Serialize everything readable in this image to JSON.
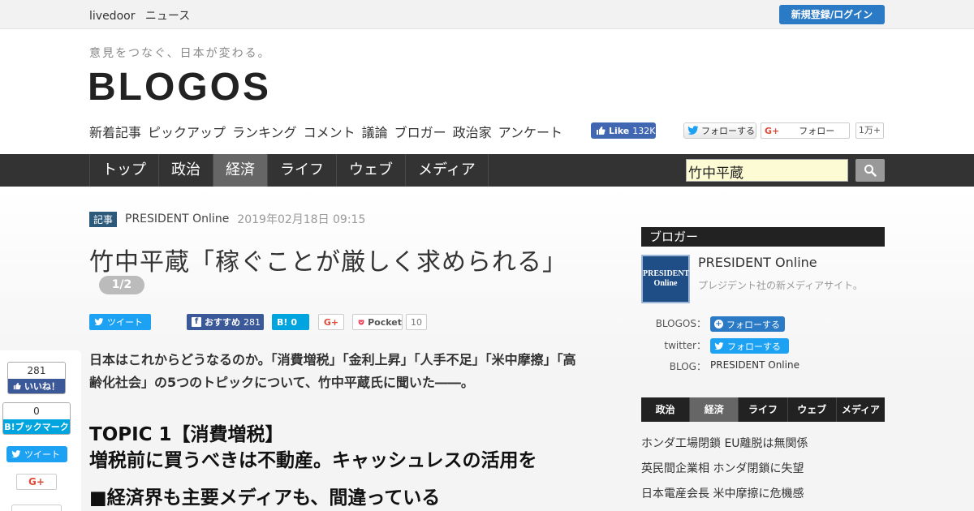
{
  "topbar": {
    "brand1": "livedoor",
    "brand2": "ニュース",
    "login": "新規登録/ログイン"
  },
  "header": {
    "tagline": "意見をつなぐ、日本が変わる。",
    "logo": "BLOGOS",
    "nav": [
      "新着記事",
      "ピックアップ",
      "ランキング",
      "コメント",
      "議論",
      "ブロガー",
      "政治家",
      "アンケート"
    ],
    "fb_like_label": "Like",
    "fb_like_count": "132K",
    "tw_follow": "フォローする",
    "gp_follow": "フォロー",
    "gp_count": "1万+"
  },
  "categories": {
    "tabs": [
      "トップ",
      "政治",
      "経済",
      "ライフ",
      "ウェブ",
      "メディア"
    ],
    "active": "経済"
  },
  "search": {
    "value": "竹中平蔵"
  },
  "article": {
    "badge": "記事",
    "source": "PRESIDENT Online",
    "date": "2019年02月18日 09:15",
    "title": "竹中平蔵「稼ぐことが厳しく求められる」",
    "page": "1/2",
    "share": {
      "tweet": "ツイート",
      "fb_label": "おすすめ",
      "fb_count": "281",
      "hb_count": "0",
      "gp": "G+",
      "pocket": "Pocket",
      "pocket_count": "10"
    },
    "lead_line1": "日本はこれからどうなるのか。「消費増税」「金利上昇」「人手不足」「米中摩擦」「高",
    "lead_line2": "齢化社会」の5つのトピックについて、竹中平蔵氏に聞いた――。",
    "topic_line1": "TOPIC 1【消費増税】",
    "topic_line2": "増税前に買うべきは不動産。キャッシュレスの活用を",
    "subhead": "■経済界も主要メディアも、間違っている"
  },
  "float_share": {
    "fb_count": "281",
    "fb_label": "いいね！",
    "hb_count": "0",
    "hb_label": "B!ブックマーク",
    "tweet": "ツイート",
    "gp": "G+"
  },
  "sidebar": {
    "heading": "ブロガー",
    "logo_text_1": "PRESIDENT",
    "logo_text_2": "Online",
    "name": "PRESIDENT Online",
    "desc": "プレジデント社の新メディアサイト。",
    "blogos_label": "BLOGOS：",
    "blogos_follow": "フォローする",
    "twitter_label": "twitter：",
    "twitter_follow": "フォローする",
    "blog_label": "BLOG：",
    "blog_value": "PRESIDENT Online",
    "tabs": [
      "政治",
      "経済",
      "ライフ",
      "ウェブ",
      "メディア"
    ],
    "active_tab": "経済",
    "news": [
      "ホンダ工場閉鎖 EU離脱は無関係",
      "英民間企業相 ホンダ閉鎖に失望",
      "日本電産会長 米中摩擦に危機感"
    ]
  },
  "colors": {
    "accent_blue": "#2a7ac6",
    "twitter": "#1da1f2",
    "facebook": "#3b5998",
    "hatena": "#00a4de",
    "nav_dark": "#333333"
  }
}
